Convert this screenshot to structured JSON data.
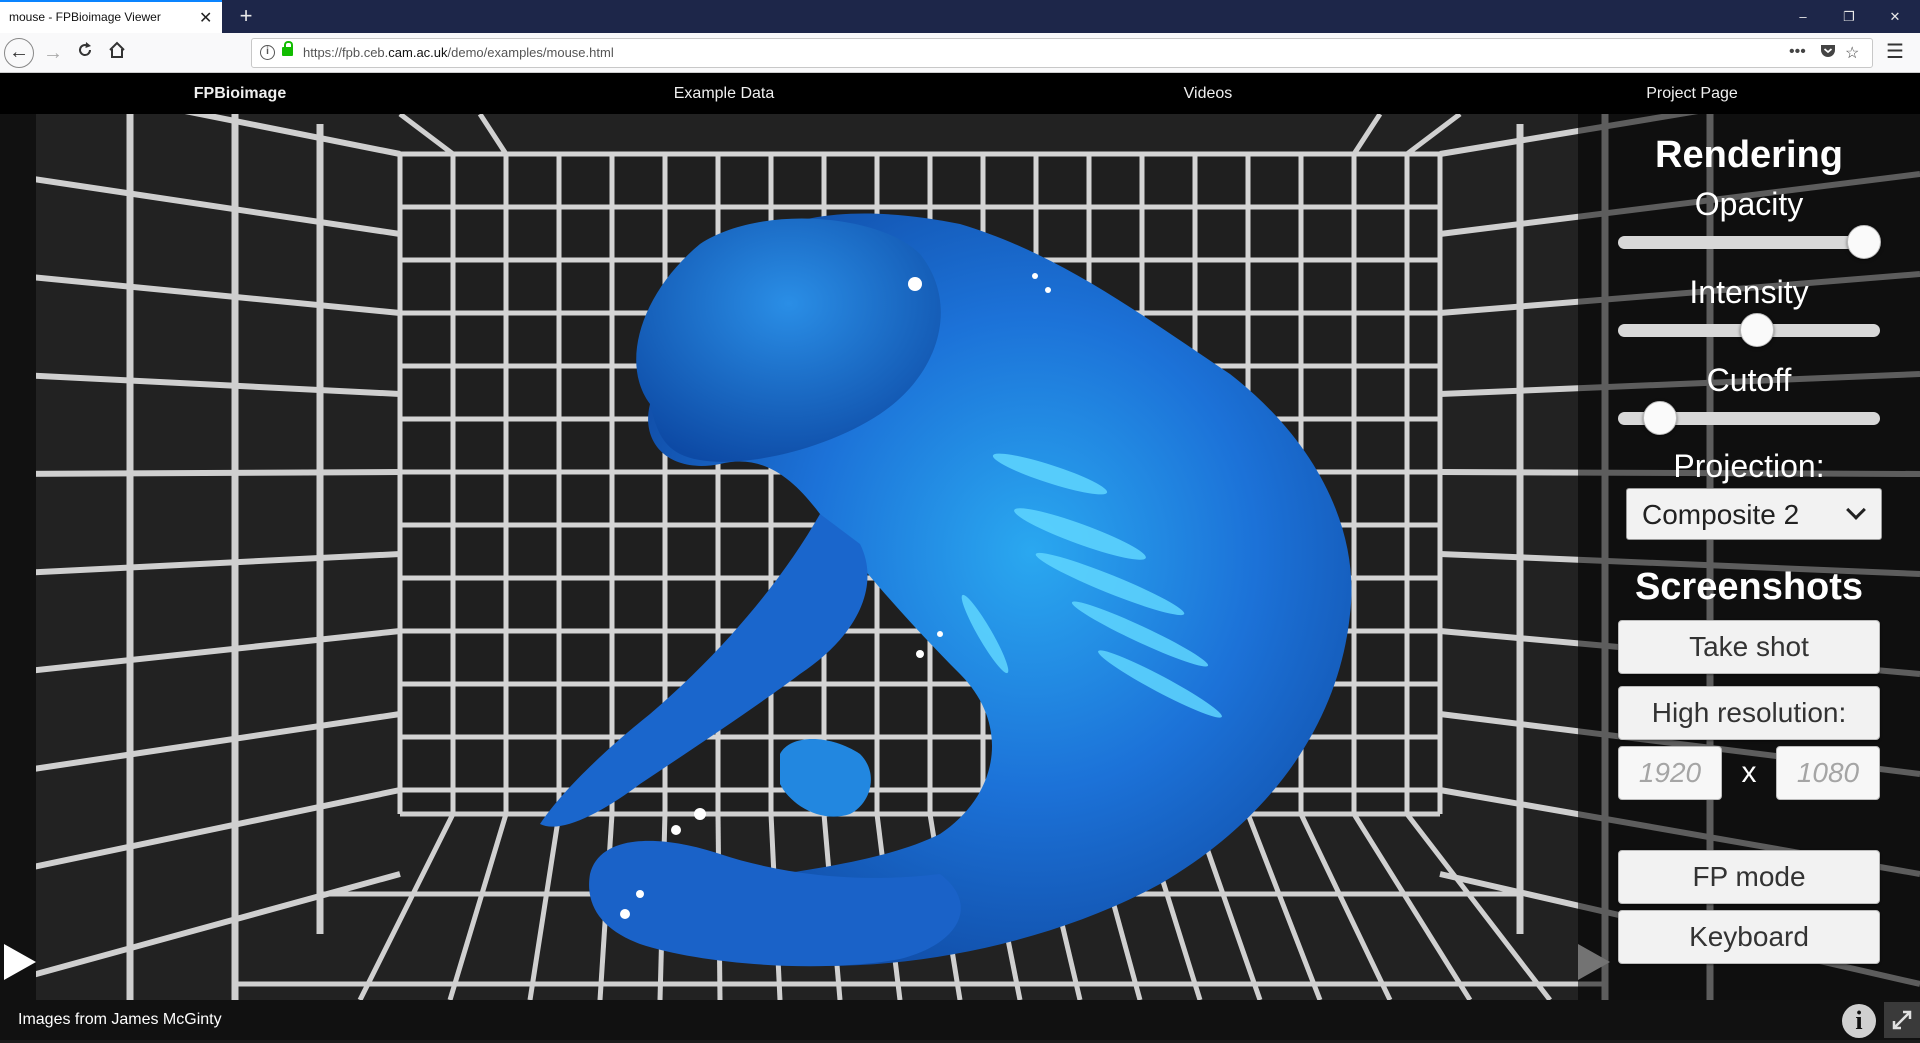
{
  "browser": {
    "tab_title": "mouse - FPBioimage Viewer",
    "tab_close_glyph": "✕",
    "new_tab_glyph": "+",
    "url_prefix": "https://fpb.ceb.",
    "url_domain": "cam.ac.uk",
    "url_suffix": "/demo/examples/mouse.html",
    "window_controls": [
      "–",
      "❐",
      "✕"
    ],
    "icons": [
      "back-icon",
      "forward-icon",
      "reload-icon",
      "home-icon",
      "info-icon",
      "lock-icon",
      "more-icon",
      "pocket-icon",
      "bookmark-star-icon",
      "hamburger-menu-icon"
    ]
  },
  "site_nav": {
    "brand": "FPBioimage",
    "items": [
      "Example Data",
      "Videos",
      "Project Page"
    ]
  },
  "panel": {
    "rendering_title": "Rendering",
    "opacity_label": "Opacity",
    "intensity_label": "Intensity",
    "cutoff_label": "Cutoff",
    "opacity_value": 0.94,
    "intensity_value": 0.53,
    "cutoff_value": 0.16,
    "projection_label": "Projection:",
    "projection_value": "Composite 2",
    "screenshots_title": "Screenshots",
    "take_shot_label": "Take shot",
    "high_res_label": "High resolution:",
    "width_placeholder": "1920",
    "height_placeholder": "1080",
    "times_glyph": "x",
    "fp_mode_label": "FP mode",
    "keyboard_label": "Keyboard"
  },
  "footer": {
    "credit": "Images from James McGinty",
    "info_glyph": "i"
  },
  "colors": {
    "specimen_blue": "#1d6fd6",
    "specimen_highlight": "#39c4ff",
    "grid_line": "#d4d4d4",
    "tab_accent": "#0a84ff"
  }
}
